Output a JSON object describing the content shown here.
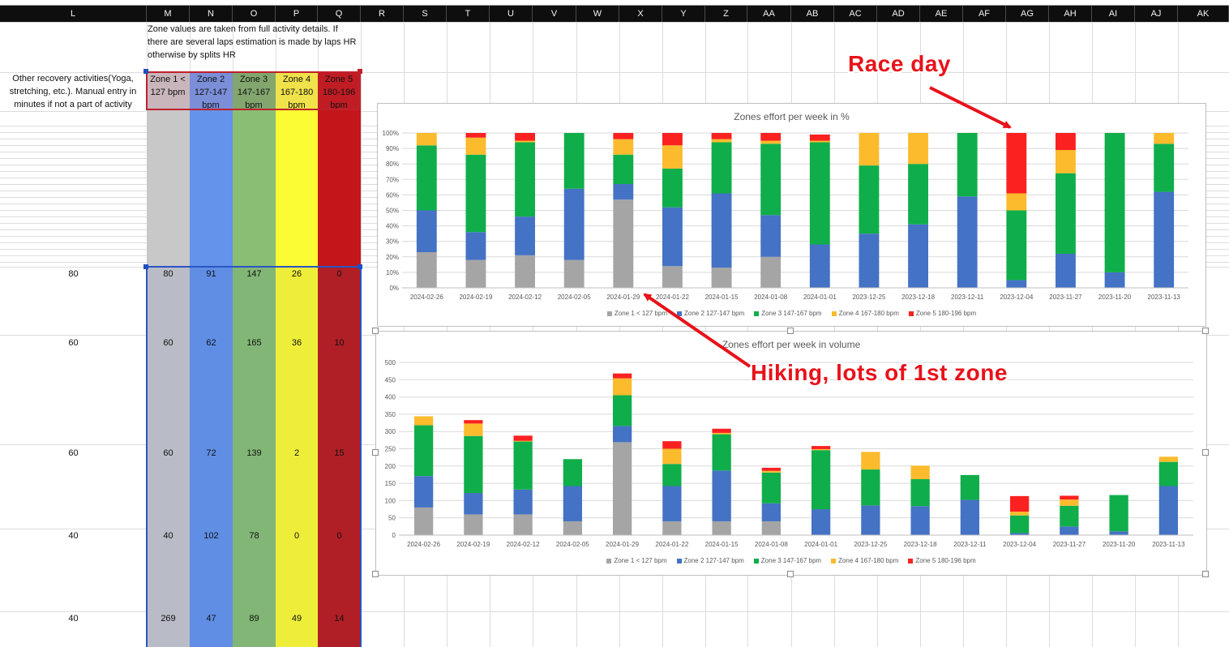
{
  "columns": [
    "L",
    "M",
    "N",
    "O",
    "P",
    "Q",
    "R",
    "S",
    "T",
    "U",
    "V",
    "W",
    "X",
    "Y",
    "Z",
    "AA",
    "AB",
    "AC",
    "AD",
    "AE",
    "AF",
    "AG",
    "AH",
    "AI",
    "AJ",
    "AK"
  ],
  "note_text": "Zone values are taken from full activity details. If there are several laps estimation is made by laps HR otherwise by splits HR",
  "recovery_header": "Other recovery activities(Yoga, stretching, etc.). Manual entry in minutes if not a part of activity",
  "zone_headers": [
    "Zone 1 < 127 bpm",
    "Zone 2 127-147 bpm",
    "Zone 3 147-167 bpm",
    "Zone 4 167-180 bpm",
    "Zone 5 180-196 bpm"
  ],
  "rows": [
    {
      "recovery": "80",
      "z": [
        "80",
        "91",
        "147",
        "26",
        "0"
      ]
    },
    {
      "recovery": "60",
      "z": [
        "60",
        "62",
        "165",
        "36",
        "10"
      ]
    },
    {
      "recovery": "60",
      "z": [
        "60",
        "72",
        "139",
        "2",
        "15"
      ]
    },
    {
      "recovery": "40",
      "z": [
        "40",
        "102",
        "78",
        "0",
        "0"
      ]
    },
    {
      "recovery": "40",
      "z": [
        "269",
        "47",
        "89",
        "49",
        "14"
      ]
    }
  ],
  "colors": {
    "zone_cells": [
      "#b9bbc6",
      "#5f8ee4",
      "#82b676",
      "#eeee3a",
      "#b01e26"
    ],
    "zone_header_bg": [
      "#c9b6bc",
      "#7b8ed8",
      "#82a66e",
      "#efe24a",
      "#c01c24"
    ],
    "series": [
      "#a5a5a5",
      "#4472c4",
      "#0fae4a",
      "#fbbb2d",
      "#fb2121"
    ],
    "annotation": "#e8121a"
  },
  "annotations": {
    "race_day": "Race day",
    "hiking": "Hiking, lots of 1st zone"
  },
  "chart_data": [
    {
      "type": "bar",
      "stacked": "percent",
      "title": "Zones effort per week in %",
      "categories": [
        "2024-02-26",
        "2024-02-19",
        "2024-02-12",
        "2024-02-05",
        "2024-01-29",
        "2024-01-22",
        "2024-01-15",
        "2024-01-08",
        "2024-01-01",
        "2023-12-25",
        "2023-12-18",
        "2023-12-11",
        "2023-12-04",
        "2023-11-27",
        "2023-11-20",
        "2023-11-13"
      ],
      "ylim": [
        0,
        100
      ],
      "yticks": [
        "0%",
        "10%",
        "20%",
        "30%",
        "40%",
        "50%",
        "60%",
        "70%",
        "80%",
        "90%",
        "100%"
      ],
      "legend": "bottom",
      "series": [
        {
          "name": "Zone 1 < 127 bpm",
          "values": [
            23,
            18,
            21,
            18,
            57,
            14,
            13,
            20,
            0,
            0,
            0,
            0,
            0,
            0,
            0,
            0
          ]
        },
        {
          "name": "Zone 2 127-147 bpm",
          "values": [
            27,
            18,
            25,
            46,
            10,
            38,
            48,
            27,
            28,
            35,
            41,
            59,
            5,
            22,
            10,
            62
          ]
        },
        {
          "name": "Zone 3 147-167 bpm",
          "values": [
            42,
            50,
            48,
            36,
            19,
            25,
            33,
            46,
            66,
            44,
            39,
            41,
            45,
            52,
            90,
            31
          ]
        },
        {
          "name": "Zone 4 167-180 bpm",
          "values": [
            8,
            11,
            1,
            0,
            10,
            15,
            2,
            2,
            1,
            21,
            20,
            0,
            11,
            15,
            0,
            7
          ]
        },
        {
          "name": "Zone 5 180-196 bpm",
          "values": [
            0,
            3,
            5,
            0,
            4,
            8,
            4,
            5,
            4,
            0,
            0,
            0,
            39,
            11,
            0,
            0
          ]
        }
      ]
    },
    {
      "type": "bar",
      "stacked": "volume",
      "title": "Zones effort per week in volume",
      "categories": [
        "2024-02-26",
        "2024-02-19",
        "2024-02-12",
        "2024-02-05",
        "2024-01-29",
        "2024-01-22",
        "2024-01-15",
        "2024-01-08",
        "2024-01-01",
        "2023-12-25",
        "2023-12-18",
        "2023-12-11",
        "2023-12-04",
        "2023-11-27",
        "2023-11-20",
        "2023-11-13"
      ],
      "ylim": [
        0,
        500
      ],
      "yticks": [
        "0",
        "50",
        "100",
        "150",
        "200",
        "250",
        "300",
        "350",
        "400",
        "450",
        "500"
      ],
      "legend": "bottom",
      "series": [
        {
          "name": "Zone 1 < 127 bpm",
          "values": [
            80,
            60,
            60,
            40,
            269,
            40,
            40,
            40,
            0,
            0,
            0,
            0,
            0,
            0,
            0,
            0
          ]
        },
        {
          "name": "Zone 2 127-147 bpm",
          "values": [
            91,
            62,
            72,
            102,
            47,
            102,
            147,
            52,
            75,
            86,
            84,
            102,
            6,
            25,
            11,
            142
          ]
        },
        {
          "name": "Zone 3 147-167 bpm",
          "values": [
            147,
            165,
            139,
            78,
            89,
            64,
            105,
            89,
            171,
            104,
            78,
            72,
            51,
            60,
            105,
            70
          ]
        },
        {
          "name": "Zone 4 167-180 bpm",
          "values": [
            26,
            36,
            2,
            0,
            49,
            44,
            4,
            5,
            3,
            51,
            39,
            0,
            11,
            18,
            0,
            15
          ]
        },
        {
          "name": "Zone 5 180-196 bpm",
          "values": [
            0,
            10,
            15,
            0,
            14,
            22,
            12,
            9,
            9,
            0,
            0,
            0,
            45,
            11,
            0,
            0
          ]
        }
      ]
    }
  ]
}
